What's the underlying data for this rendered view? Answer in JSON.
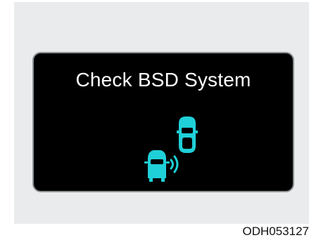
{
  "display": {
    "message": "Check BSD System"
  },
  "icons": {
    "bsd_warning_icon": "bsd-warning-icon"
  },
  "caption": "ODH053127",
  "colors": {
    "screen_background": "#000000",
    "screen_border": "#8e9294",
    "panel_background": "#e9ebec",
    "icon_color": "#1fd0d8",
    "message_color": "#ffffff"
  }
}
